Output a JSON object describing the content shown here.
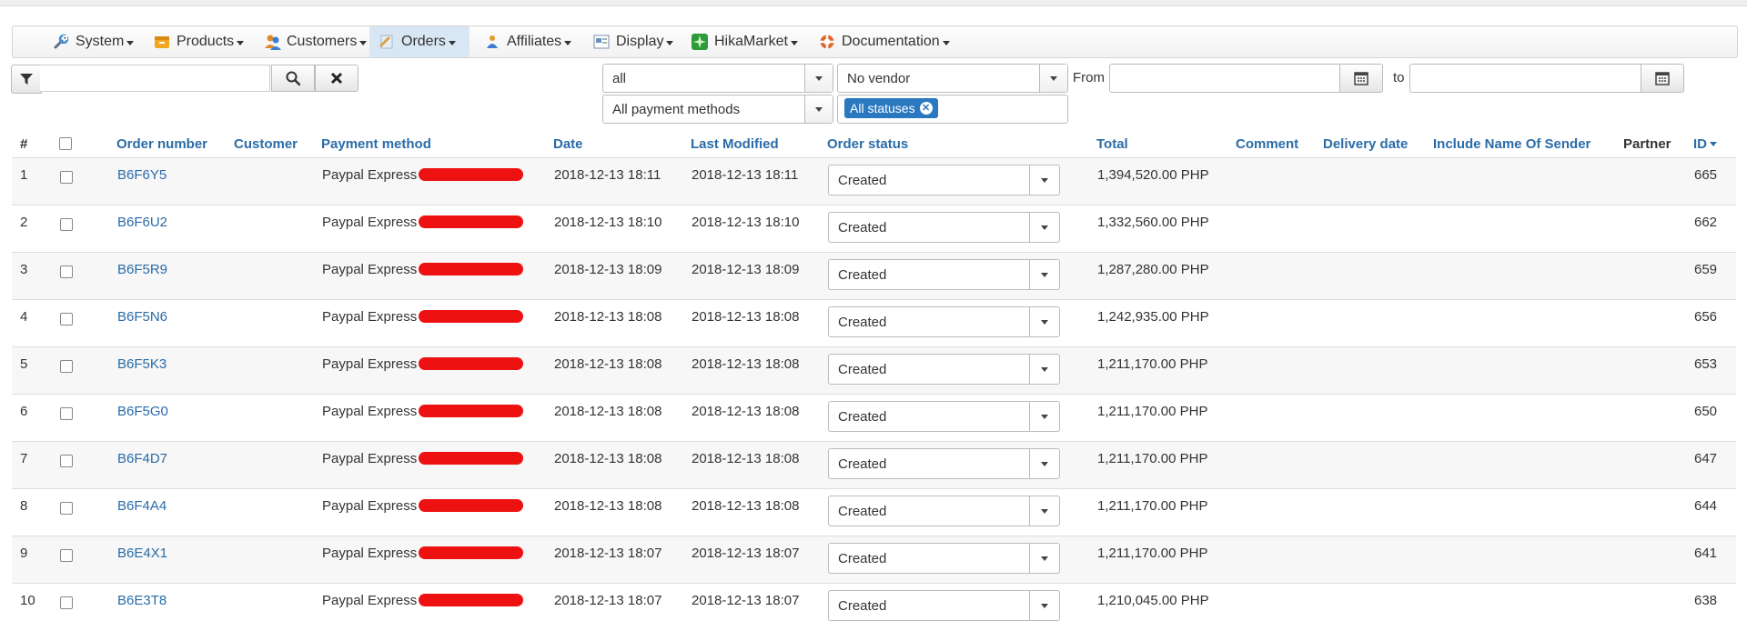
{
  "menu": [
    {
      "label": "System",
      "icon": "wrench-icon",
      "color": "#5b6f87"
    },
    {
      "label": "Products",
      "icon": "box-icon",
      "color": "#f0a020"
    },
    {
      "label": "Customers",
      "icon": "users-icon",
      "color": "#e08a2a"
    },
    {
      "label": "Orders",
      "icon": "order-icon",
      "color": "#a0b7d4"
    },
    {
      "label": "Affiliates",
      "icon": "affiliate-icon",
      "color": "#3d7fcf"
    },
    {
      "label": "Display",
      "icon": "display-icon",
      "color": "#6a8fc0"
    },
    {
      "label": "HikaMarket",
      "icon": "hikamarket-icon",
      "color": "#2e9b3a"
    },
    {
      "label": "Documentation",
      "icon": "lifebuoy-icon",
      "color": "#e0652a"
    }
  ],
  "filters": {
    "search_value": "",
    "vendor_scope": "all",
    "vendor": "No vendor",
    "payment": "All payment methods",
    "status_tag": "All statuses",
    "from_label": "From",
    "to_label": "to"
  },
  "table": {
    "headers": {
      "num": "#",
      "order_number": "Order number",
      "customer": "Customer",
      "payment_method": "Payment method",
      "date": "Date",
      "last_modified": "Last Modified",
      "order_status": "Order status",
      "total": "Total",
      "comment": "Comment",
      "delivery_date": "Delivery date",
      "include_name": "Include Name Of Sender",
      "partner": "Partner",
      "id": "ID"
    },
    "rows": [
      {
        "num": "1",
        "order": "B6F6Y5",
        "payment": "Paypal Express",
        "date": "2018-12-13 18:11",
        "modified": "2018-12-13 18:11",
        "status": "Created",
        "total": "1,394,520.00 PHP",
        "id": "665"
      },
      {
        "num": "2",
        "order": "B6F6U2",
        "payment": "Paypal Express",
        "date": "2018-12-13 18:10",
        "modified": "2018-12-13 18:10",
        "status": "Created",
        "total": "1,332,560.00 PHP",
        "id": "662"
      },
      {
        "num": "3",
        "order": "B6F5R9",
        "payment": "Paypal Express",
        "date": "2018-12-13 18:09",
        "modified": "2018-12-13 18:09",
        "status": "Created",
        "total": "1,287,280.00 PHP",
        "id": "659"
      },
      {
        "num": "4",
        "order": "B6F5N6",
        "payment": "Paypal Express",
        "date": "2018-12-13 18:08",
        "modified": "2018-12-13 18:08",
        "status": "Created",
        "total": "1,242,935.00 PHP",
        "id": "656"
      },
      {
        "num": "5",
        "order": "B6F5K3",
        "payment": "Paypal Express",
        "date": "2018-12-13 18:08",
        "modified": "2018-12-13 18:08",
        "status": "Created",
        "total": "1,211,170.00 PHP",
        "id": "653"
      },
      {
        "num": "6",
        "order": "B6F5G0",
        "payment": "Paypal Express",
        "date": "2018-12-13 18:08",
        "modified": "2018-12-13 18:08",
        "status": "Created",
        "total": "1,211,170.00 PHP",
        "id": "650"
      },
      {
        "num": "7",
        "order": "B6F4D7",
        "payment": "Paypal Express",
        "date": "2018-12-13 18:08",
        "modified": "2018-12-13 18:08",
        "status": "Created",
        "total": "1,211,170.00 PHP",
        "id": "647"
      },
      {
        "num": "8",
        "order": "B6F4A4",
        "payment": "Paypal Express",
        "date": "2018-12-13 18:08",
        "modified": "2018-12-13 18:08",
        "status": "Created",
        "total": "1,211,170.00 PHP",
        "id": "644"
      },
      {
        "num": "9",
        "order": "B6E4X1",
        "payment": "Paypal Express",
        "date": "2018-12-13 18:07",
        "modified": "2018-12-13 18:07",
        "status": "Created",
        "total": "1,211,170.00 PHP",
        "id": "641"
      },
      {
        "num": "10",
        "order": "B6E3T8",
        "payment": "Paypal Express",
        "date": "2018-12-13 18:07",
        "modified": "2018-12-13 18:07",
        "status": "Created",
        "total": "1,210,045.00 PHP",
        "id": "638"
      }
    ]
  }
}
